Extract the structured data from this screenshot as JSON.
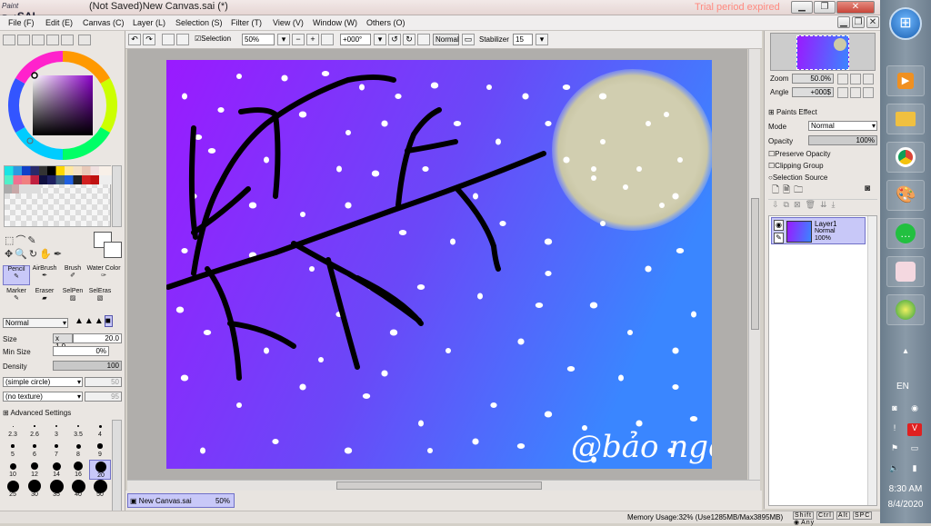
{
  "app": {
    "logo_small": "Paint Tool",
    "logo_big": "SAI",
    "title": "(Not Saved)New Canvas.sai (*)",
    "trial_notice": "Trial period expired"
  },
  "menu": [
    "File (F)",
    "Edit (E)",
    "Canvas (C)",
    "Layer (L)",
    "Selection (S)",
    "Filter (T)",
    "View (V)",
    "Window (W)",
    "Others (O)"
  ],
  "toolbar": {
    "selection_label": "Selection",
    "selection_checked": true,
    "zoom": "50%",
    "rotation": "+000°",
    "blend": "Normal",
    "stabilizer_label": "Stabilizer",
    "stabilizer": "15"
  },
  "tools_row1": [
    "Pencil",
    "AirBrush",
    "Brush",
    "Water Color"
  ],
  "tools_row2": [
    "Marker",
    "Eraser",
    "SelPen",
    "SelEras"
  ],
  "brush": {
    "mode": "Normal",
    "size_label": "Size",
    "size_mult": "x 1.0",
    "size": "20.0",
    "min_size_label": "Min Size",
    "min_size": "0%",
    "density_label": "Density",
    "density": "100",
    "shape": "(simple circle)",
    "shape_value": "50",
    "texture": "(no texture)",
    "texture_value": "95",
    "advanced_label": "Advanced Settings"
  },
  "brush_sizes": [
    {
      "label": "2.3",
      "d": 1
    },
    {
      "label": "2.6",
      "d": 1.5
    },
    {
      "label": "3",
      "d": 2
    },
    {
      "label": "3.5",
      "d": 2.5
    },
    {
      "label": "4",
      "d": 3
    },
    {
      "label": "5",
      "d": 3.5
    },
    {
      "label": "6",
      "d": 4
    },
    {
      "label": "7",
      "d": 4.5
    },
    {
      "label": "8",
      "d": 5
    },
    {
      "label": "9",
      "d": 5.5
    },
    {
      "label": "10",
      "d": 7
    },
    {
      "label": "12",
      "d": 8
    },
    {
      "label": "14",
      "d": 9
    },
    {
      "label": "16",
      "d": 10
    },
    {
      "label": "20",
      "d": 12
    },
    {
      "label": "25",
      "d": 13
    },
    {
      "label": "30",
      "d": 14
    },
    {
      "label": "35",
      "d": 15
    },
    {
      "label": "40",
      "d": 15
    },
    {
      "label": "50",
      "d": 15
    }
  ],
  "selected_brush_size": "20",
  "navigator": {
    "zoom_label": "Zoom",
    "zoom": "50.0%",
    "angle_label": "Angle",
    "angle": "+000$"
  },
  "paints_effect": {
    "title": "Paints Effect",
    "mode_label": "Mode",
    "mode": "Normal",
    "opacity_label": "Opacity",
    "opacity": "100%",
    "checks": [
      "Preserve Opacity",
      "Clipping Group",
      "Selection Source"
    ]
  },
  "layer": {
    "name": "Layer1",
    "mode": "Normal",
    "opacity": "100%"
  },
  "doc_tab": {
    "name": "New Canvas.sai",
    "zoom": "50%"
  },
  "status": {
    "memory": "Memory Usage:32% (Use1285MB/Max3895MB)",
    "keys": [
      "Shift",
      "Ctrl",
      "Alt",
      "SPC",
      "Any"
    ]
  },
  "artwork": {
    "signature": "@bảo ngọc"
  },
  "taskbar": {
    "language": "EN",
    "time": "8:30 AM",
    "date": "8/4/2020"
  },
  "colors": {
    "canvas_purple": "#9a1aff",
    "canvas_blue": "#3a86ff",
    "moon": "#cdcaa8",
    "accent_selection": "#c8c8f8"
  }
}
